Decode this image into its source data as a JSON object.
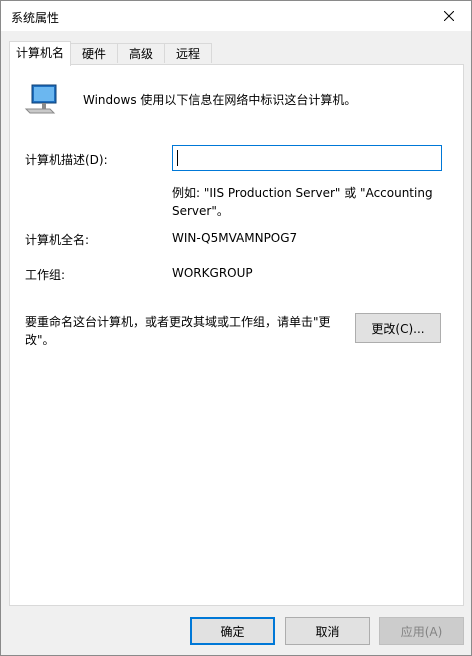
{
  "window": {
    "title": "系统属性"
  },
  "tabs": [
    {
      "label": "计算机名",
      "active": true
    },
    {
      "label": "硬件",
      "active": false
    },
    {
      "label": "高级",
      "active": false
    },
    {
      "label": "远程",
      "active": false
    }
  ],
  "panel": {
    "intro_text": "Windows 使用以下信息在网络中标识这台计算机。",
    "description_label": "计算机描述(D):",
    "description_value": "",
    "example_line1": "例如: \"IIS Production Server\" 或 \"Accounting",
    "example_line2": "Server\"。",
    "full_name_label": "计算机全名:",
    "full_name_value": "WIN-Q5MVAMNPOG7",
    "workgroup_label": "工作组:",
    "workgroup_value": "WORKGROUP",
    "rename_line1": "要重命名这台计算机，或者更改其域或工作组，请单击\"更",
    "rename_line2": "改\"。",
    "change_button": "更改(C)..."
  },
  "footer": {
    "ok_button": "确定",
    "cancel_button": "取消",
    "apply_button": "应用(A)"
  },
  "icons": {
    "computer": "computer-icon",
    "close": "close-icon"
  },
  "colors": {
    "accent": "#0078d7",
    "panel_bg": "#ffffff",
    "dialog_bg": "#f0f0f0"
  }
}
